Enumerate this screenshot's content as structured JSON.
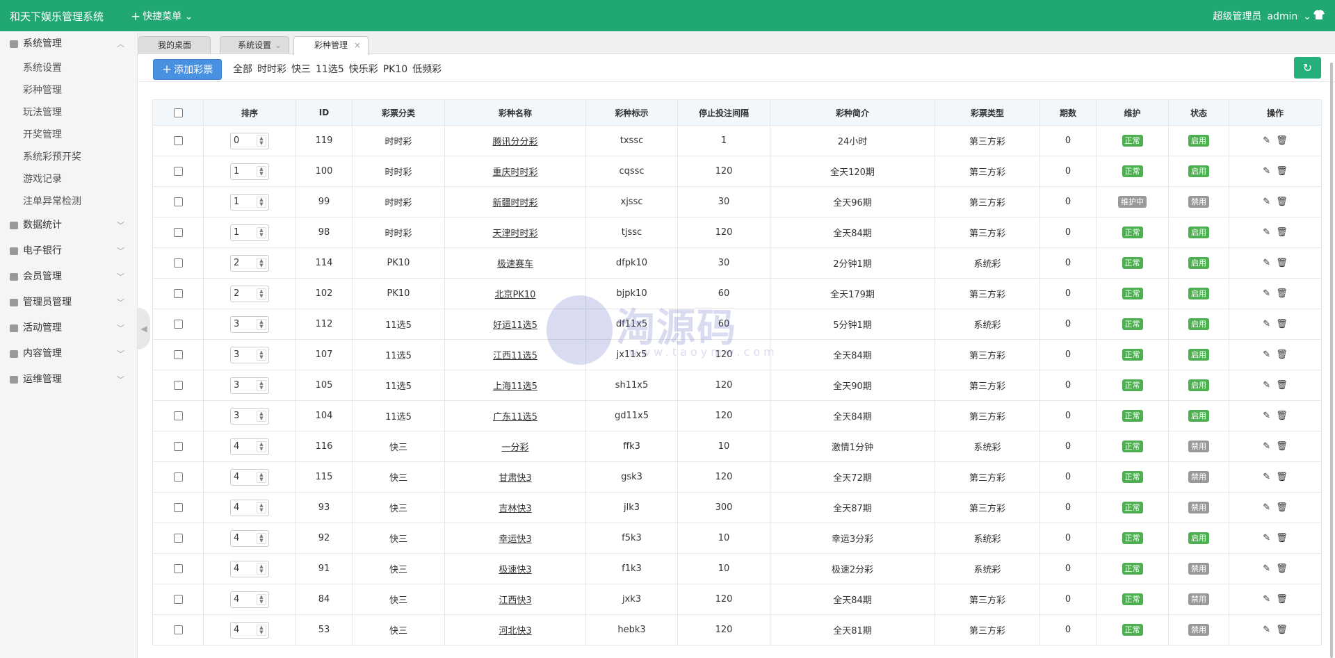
{
  "app": {
    "title": "和天下娱乐管理系统",
    "quick_menu": "快捷菜单",
    "role": "超级管理员",
    "user": "admin"
  },
  "sidebar": {
    "groups": [
      {
        "label": "系统管理",
        "expanded": true,
        "items": [
          "系统设置",
          "彩种管理",
          "玩法管理",
          "开奖管理",
          "系统彩预开奖",
          "游戏记录",
          "注单异常检测"
        ]
      },
      {
        "label": "数据统计"
      },
      {
        "label": "电子银行"
      },
      {
        "label": "会员管理"
      },
      {
        "label": "管理员管理"
      },
      {
        "label": "活动管理"
      },
      {
        "label": "内容管理"
      },
      {
        "label": "运维管理"
      }
    ]
  },
  "tabs": [
    {
      "label": "我的桌面"
    },
    {
      "label": "系统设置"
    },
    {
      "label": "彩种管理"
    }
  ],
  "toolbar": {
    "add_label": "添加彩票",
    "filters": [
      "全部",
      "时时彩",
      "快三",
      "11选5",
      "快乐彩",
      "PK10",
      "低频彩"
    ]
  },
  "table": {
    "headers": [
      "排序",
      "ID",
      "彩票分类",
      "彩种名称",
      "彩种标示",
      "停止投注间隔",
      "彩种简介",
      "彩票类型",
      "期数",
      "维护",
      "状态",
      "操作"
    ],
    "rows": [
      {
        "sort": "0",
        "id": "119",
        "cat": "时时彩",
        "name": "腾讯分分彩",
        "code": "txssc",
        "interval": "1",
        "desc": "24小时",
        "type": "第三方彩",
        "periods": "0",
        "maint": "正常",
        "status": "启用"
      },
      {
        "sort": "1",
        "id": "100",
        "cat": "时时彩",
        "name": "重庆时时彩",
        "code": "cqssc",
        "interval": "120",
        "desc": "全天120期",
        "type": "第三方彩",
        "periods": "0",
        "maint": "正常",
        "status": "启用"
      },
      {
        "sort": "1",
        "id": "99",
        "cat": "时时彩",
        "name": "新疆时时彩",
        "code": "xjssc",
        "interval": "30",
        "desc": "全天96期",
        "type": "第三方彩",
        "periods": "0",
        "maint": "维护中",
        "status": "禁用"
      },
      {
        "sort": "1",
        "id": "98",
        "cat": "时时彩",
        "name": "天津时时彩",
        "code": "tjssc",
        "interval": "120",
        "desc": "全天84期",
        "type": "第三方彩",
        "periods": "0",
        "maint": "正常",
        "status": "启用"
      },
      {
        "sort": "2",
        "id": "114",
        "cat": "PK10",
        "name": "极速赛车",
        "code": "dfpk10",
        "interval": "30",
        "desc": "2分钟1期",
        "type": "系统彩",
        "periods": "0",
        "maint": "正常",
        "status": "启用"
      },
      {
        "sort": "2",
        "id": "102",
        "cat": "PK10",
        "name": "北京PK10",
        "code": "bjpk10",
        "interval": "60",
        "desc": "全天179期",
        "type": "第三方彩",
        "periods": "0",
        "maint": "正常",
        "status": "启用"
      },
      {
        "sort": "3",
        "id": "112",
        "cat": "11选5",
        "name": "好运11选5",
        "code": "df11x5",
        "interval": "60",
        "desc": "5分钟1期",
        "type": "系统彩",
        "periods": "0",
        "maint": "正常",
        "status": "启用"
      },
      {
        "sort": "3",
        "id": "107",
        "cat": "11选5",
        "name": "江西11选5",
        "code": "jx11x5",
        "interval": "120",
        "desc": "全天84期",
        "type": "第三方彩",
        "periods": "0",
        "maint": "正常",
        "status": "启用"
      },
      {
        "sort": "3",
        "id": "105",
        "cat": "11选5",
        "name": "上海11选5",
        "code": "sh11x5",
        "interval": "120",
        "desc": "全天90期",
        "type": "第三方彩",
        "periods": "0",
        "maint": "正常",
        "status": "启用"
      },
      {
        "sort": "3",
        "id": "104",
        "cat": "11选5",
        "name": "广东11选5",
        "code": "gd11x5",
        "interval": "120",
        "desc": "全天84期",
        "type": "第三方彩",
        "periods": "0",
        "maint": "正常",
        "status": "启用"
      },
      {
        "sort": "4",
        "id": "116",
        "cat": "快三",
        "name": "一分彩",
        "code": "ffk3",
        "interval": "10",
        "desc": "激情1分钟",
        "type": "系统彩",
        "periods": "0",
        "maint": "正常",
        "status": "禁用"
      },
      {
        "sort": "4",
        "id": "115",
        "cat": "快三",
        "name": "甘肃快3",
        "code": "gsk3",
        "interval": "120",
        "desc": "全天72期",
        "type": "第三方彩",
        "periods": "0",
        "maint": "正常",
        "status": "禁用"
      },
      {
        "sort": "4",
        "id": "93",
        "cat": "快三",
        "name": "吉林快3",
        "code": "jlk3",
        "interval": "300",
        "desc": "全天87期",
        "type": "第三方彩",
        "periods": "0",
        "maint": "正常",
        "status": "禁用"
      },
      {
        "sort": "4",
        "id": "92",
        "cat": "快三",
        "name": "幸运快3",
        "code": "f5k3",
        "interval": "10",
        "desc": "幸运3分彩",
        "type": "系统彩",
        "periods": "0",
        "maint": "正常",
        "status": "启用"
      },
      {
        "sort": "4",
        "id": "91",
        "cat": "快三",
        "name": "极速快3",
        "code": "f1k3",
        "interval": "10",
        "desc": "极速2分彩",
        "type": "系统彩",
        "periods": "0",
        "maint": "正常",
        "status": "禁用"
      },
      {
        "sort": "4",
        "id": "84",
        "cat": "快三",
        "name": "江西快3",
        "code": "jxk3",
        "interval": "120",
        "desc": "全天84期",
        "type": "第三方彩",
        "periods": "0",
        "maint": "正常",
        "status": "禁用"
      },
      {
        "sort": "4",
        "id": "53",
        "cat": "快三",
        "name": "河北快3",
        "code": "hebk3",
        "interval": "120",
        "desc": "全天81期",
        "type": "第三方彩",
        "periods": "0",
        "maint": "正常",
        "status": "禁用"
      }
    ]
  },
  "watermark": {
    "text": "淘源码",
    "url": "www.taoymw.com"
  },
  "colors": {
    "header": "#20a772",
    "primary_button": "#4891e0",
    "badge_ok": "#4cb050",
    "badge_off": "#999999"
  }
}
